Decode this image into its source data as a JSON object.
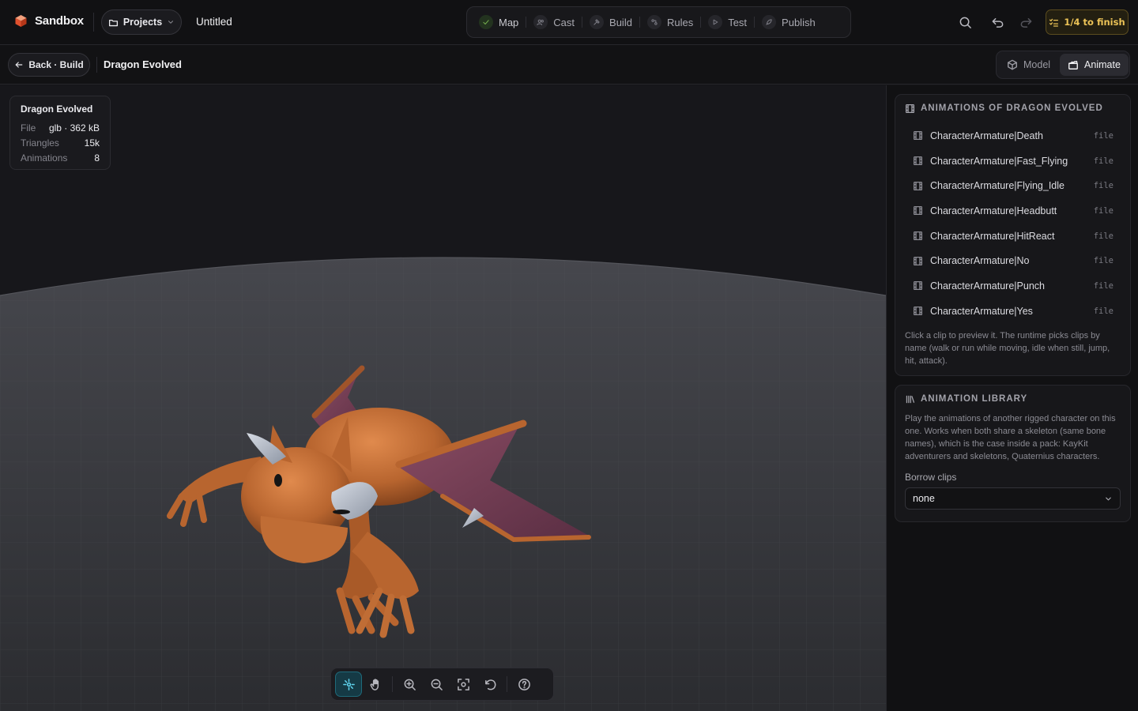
{
  "app": {
    "name": "Sandbox",
    "projects_label": "Projects",
    "doc_title": "Untitled"
  },
  "nav": {
    "steps": [
      {
        "label": "Map",
        "icon": "check-icon",
        "done": true
      },
      {
        "label": "Cast",
        "icon": "people-icon",
        "done": false
      },
      {
        "label": "Build",
        "icon": "hammer-icon",
        "done": false
      },
      {
        "label": "Rules",
        "icon": "rules-icon",
        "done": false
      },
      {
        "label": "Test",
        "icon": "play-icon",
        "done": false
      },
      {
        "label": "Publish",
        "icon": "rocket-icon",
        "done": false
      }
    ]
  },
  "progress": {
    "label": "1/4 to finish",
    "color": "#ecc357"
  },
  "subbar": {
    "back_label": "Back · Build",
    "asset_title": "Dragon Evolved",
    "mode_model": "Model",
    "mode_animate": "Animate",
    "active_mode": "Animate"
  },
  "info": {
    "title": "Dragon Evolved",
    "rows": [
      {
        "k": "File",
        "v": "glb · 362 kB"
      },
      {
        "k": "Triangles",
        "v": "15k"
      },
      {
        "k": "Animations",
        "v": "8"
      }
    ]
  },
  "animations": {
    "title": "ANIMATIONS OF DRAGON EVOLVED",
    "items": [
      {
        "name": "CharacterArmature|Death",
        "tag": "file"
      },
      {
        "name": "CharacterArmature|Fast_Flying",
        "tag": "file"
      },
      {
        "name": "CharacterArmature|Flying_Idle",
        "tag": "file"
      },
      {
        "name": "CharacterArmature|Headbutt",
        "tag": "file"
      },
      {
        "name": "CharacterArmature|HitReact",
        "tag": "file"
      },
      {
        "name": "CharacterArmature|No",
        "tag": "file"
      },
      {
        "name": "CharacterArmature|Punch",
        "tag": "file"
      },
      {
        "name": "CharacterArmature|Yes",
        "tag": "file"
      }
    ],
    "note": "Click a clip to preview it. The runtime picks clips by name (walk or run while moving, idle when still, jump, hit, attack)."
  },
  "library": {
    "title": "ANIMATION LIBRARY",
    "note": "Play the animations of another rigged character on this one. Works when both share a skeleton (same bone names), which is the case inside a pack: KayKit adventurers and skeletons, Quaternius characters.",
    "borrow_label": "Borrow clips",
    "borrow_value": "none"
  },
  "colors": {
    "accent": "#5fd2ec",
    "dragon": "#b8652f",
    "wing": "#6e3a52"
  }
}
